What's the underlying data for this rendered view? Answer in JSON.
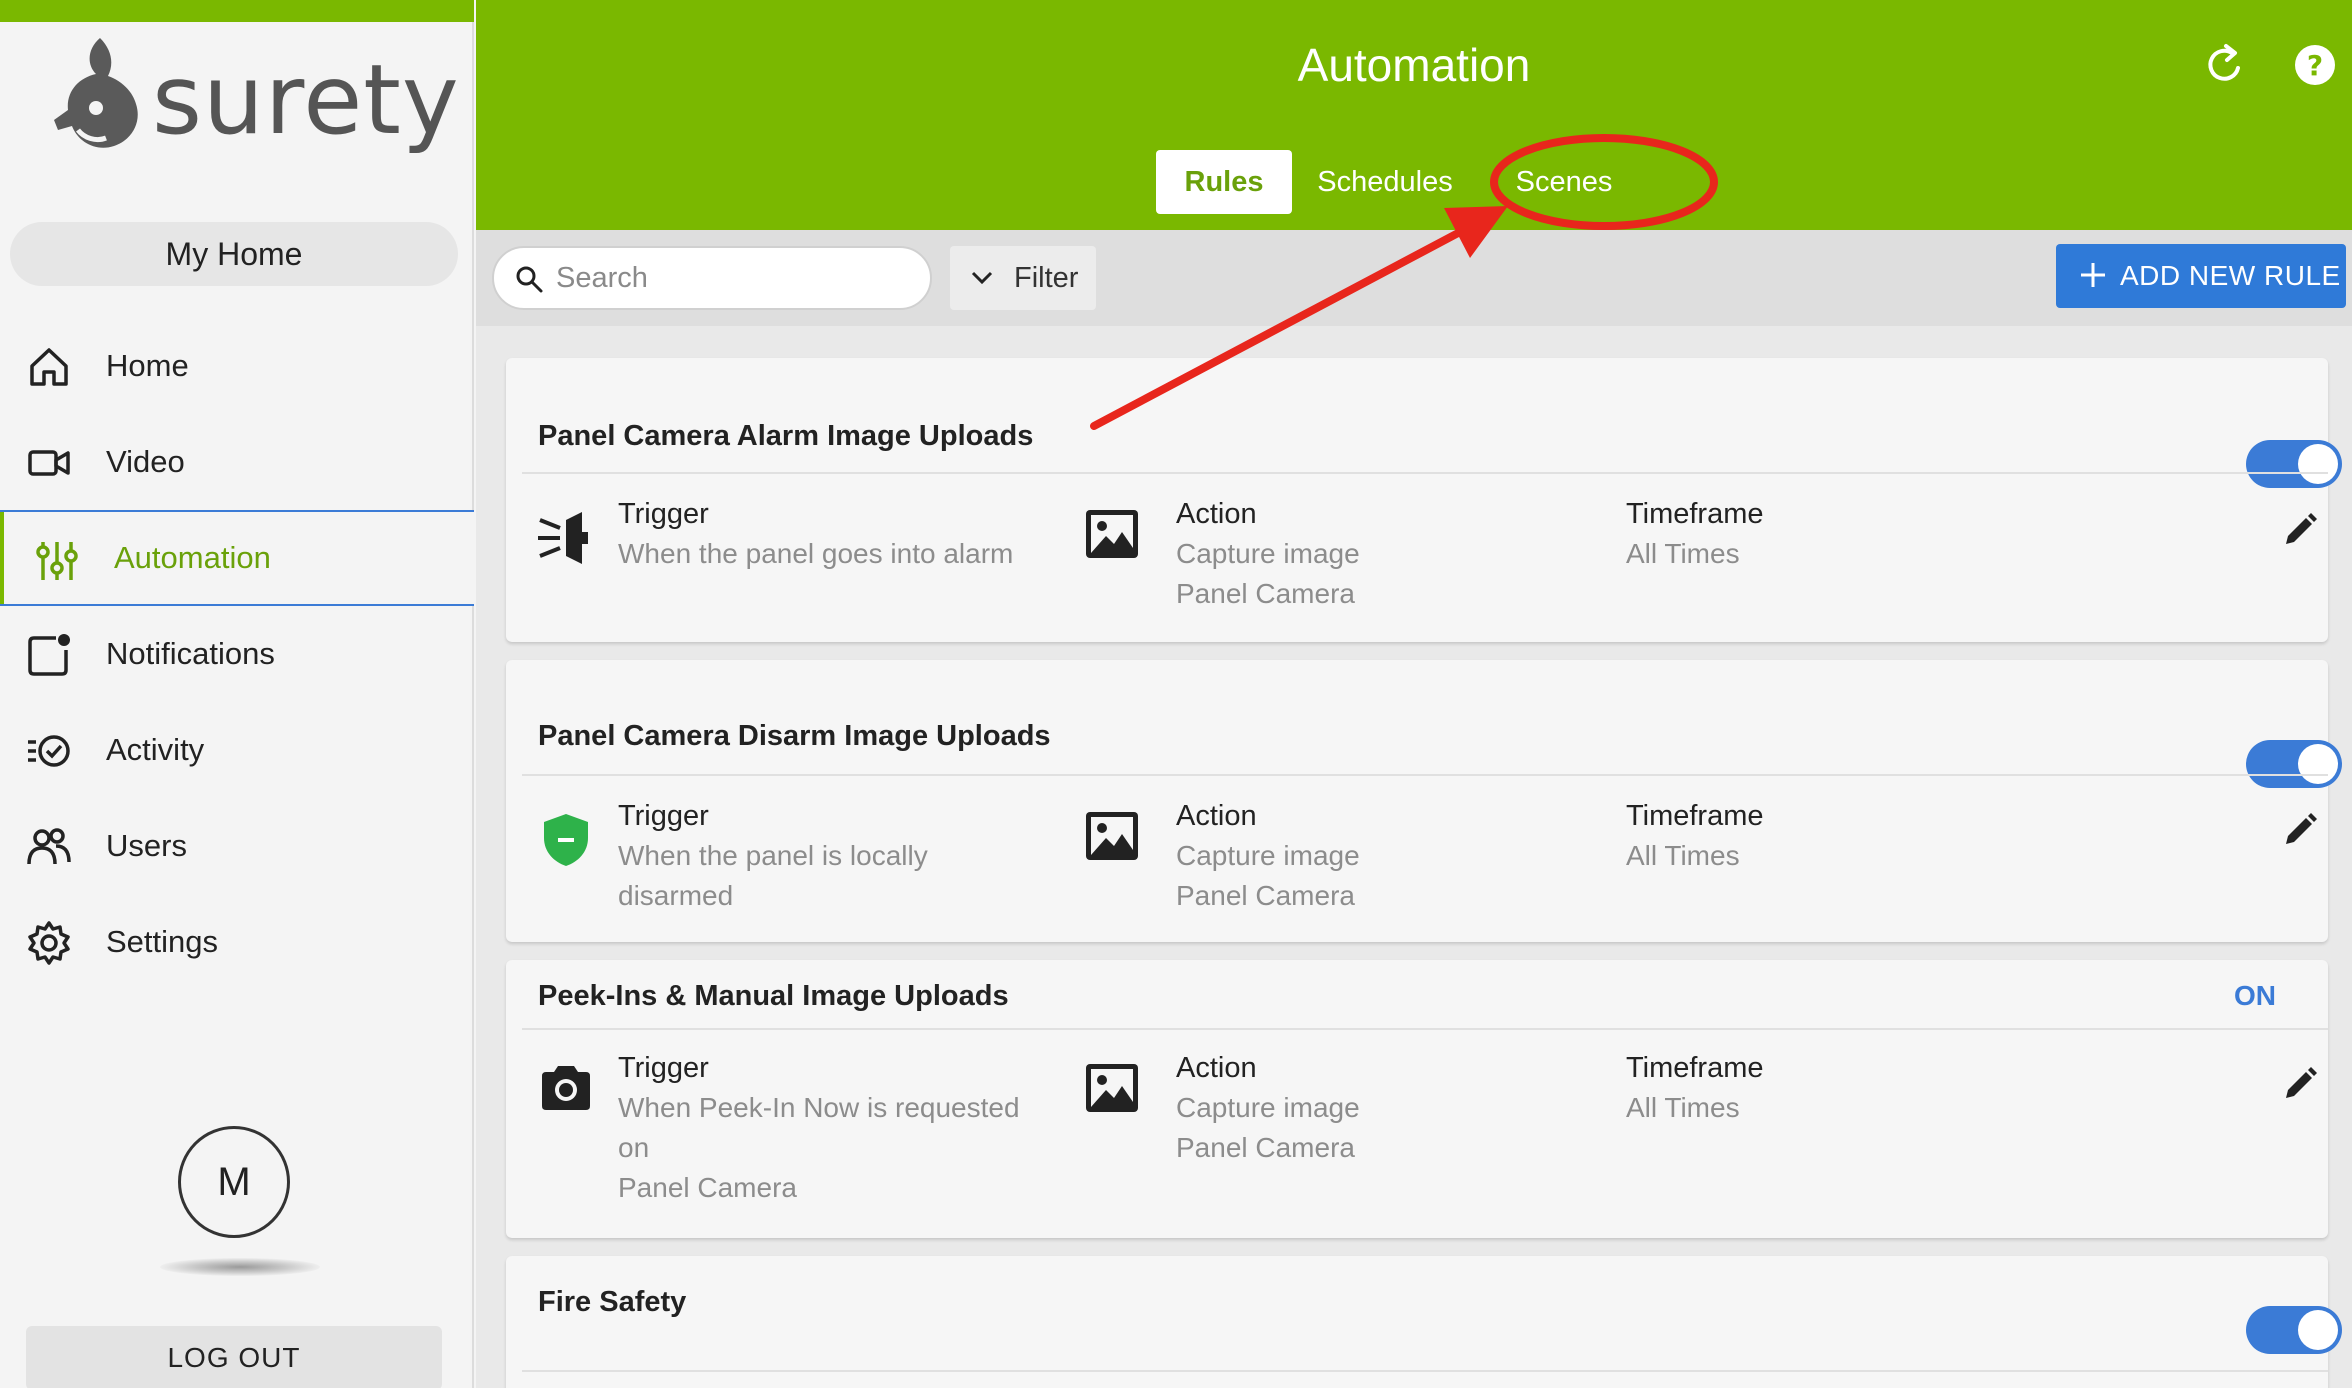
{
  "brand": {
    "logo_text": "surety"
  },
  "sidebar": {
    "location": "My Home",
    "items": [
      {
        "label": "Home",
        "icon": "home-icon"
      },
      {
        "label": "Video",
        "icon": "video-icon"
      },
      {
        "label": "Automation",
        "icon": "sliders-icon",
        "active": true
      },
      {
        "label": "Notifications",
        "icon": "notification-icon"
      },
      {
        "label": "Activity",
        "icon": "activity-icon"
      },
      {
        "label": "Users",
        "icon": "users-icon"
      },
      {
        "label": "Settings",
        "icon": "gear-icon"
      }
    ],
    "avatar_initial": "M",
    "logout_label": "LOG OUT"
  },
  "header": {
    "title": "Automation",
    "tabs": [
      {
        "label": "Rules",
        "active": true
      },
      {
        "label": "Schedules"
      },
      {
        "label": "Scenes"
      }
    ]
  },
  "toolbar": {
    "search_placeholder": "Search",
    "filter_label": "Filter",
    "add_label": "ADD NEW RULE"
  },
  "rules": [
    {
      "title": "Panel Camera Alarm Image Uploads",
      "status": "toggle-on",
      "trigger_label": "Trigger",
      "trigger_text": [
        "When the panel goes into alarm"
      ],
      "action_label": "Action",
      "action_text": [
        "Capture image",
        "Panel Camera"
      ],
      "timeframe_label": "Timeframe",
      "timeframe_text": "All Times"
    },
    {
      "title": "Panel Camera Disarm Image Uploads",
      "status": "toggle-on",
      "trigger_label": "Trigger",
      "trigger_text": [
        "When the panel is locally",
        "disarmed"
      ],
      "action_label": "Action",
      "action_text": [
        "Capture image",
        "Panel Camera"
      ],
      "timeframe_label": "Timeframe",
      "timeframe_text": "All Times"
    },
    {
      "title": "Peek-Ins & Manual Image Uploads",
      "status_text": "ON",
      "trigger_label": "Trigger",
      "trigger_text": [
        "When Peek-In Now is requested",
        "on",
        "Panel Camera"
      ],
      "action_label": "Action",
      "action_text": [
        "Capture image",
        "Panel Camera"
      ],
      "timeframe_label": "Timeframe",
      "timeframe_text": "All Times"
    },
    {
      "title": "Fire Safety",
      "status": "toggle-on"
    }
  ],
  "colors": {
    "brand_green": "#7ab800",
    "accent_blue": "#3b7bd6",
    "annotation_red": "#e8261c"
  }
}
